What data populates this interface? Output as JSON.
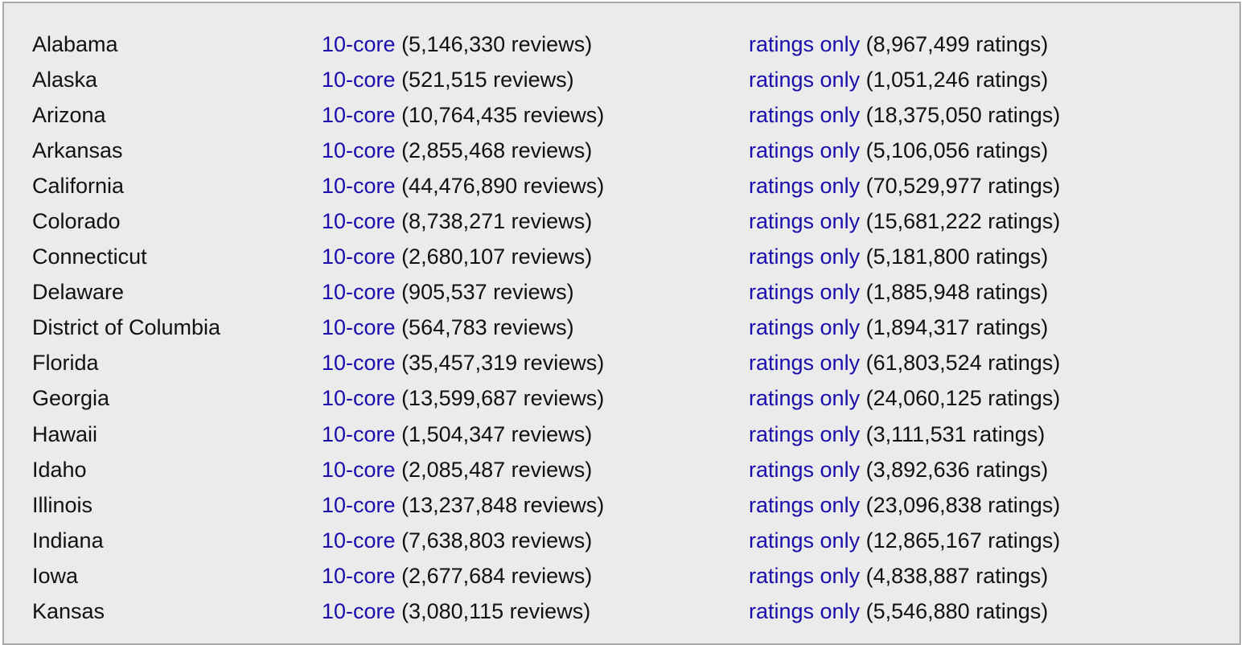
{
  "link_labels": {
    "core": "10-core",
    "ratings": "ratings only"
  },
  "colors": {
    "link": "#1a0dab",
    "text": "#111111",
    "background": "#ebebeb",
    "border": "#a9a9a9"
  },
  "rows": [
    {
      "state": "Alabama",
      "reviews": "(5,146,330 reviews)",
      "ratings": "(8,967,499 ratings)"
    },
    {
      "state": "Alaska",
      "reviews": "(521,515 reviews)",
      "ratings": "(1,051,246 ratings)"
    },
    {
      "state": "Arizona",
      "reviews": "(10,764,435 reviews)",
      "ratings": "(18,375,050 ratings)"
    },
    {
      "state": "Arkansas",
      "reviews": "(2,855,468 reviews)",
      "ratings": "(5,106,056 ratings)"
    },
    {
      "state": "California",
      "reviews": "(44,476,890 reviews)",
      "ratings": "(70,529,977 ratings)"
    },
    {
      "state": "Colorado",
      "reviews": "(8,738,271 reviews)",
      "ratings": "(15,681,222 ratings)"
    },
    {
      "state": "Connecticut",
      "reviews": "(2,680,107 reviews)",
      "ratings": "(5,181,800 ratings)"
    },
    {
      "state": "Delaware",
      "reviews": "(905,537 reviews)",
      "ratings": "(1,885,948 ratings)"
    },
    {
      "state": "District of Columbia",
      "reviews": "(564,783 reviews)",
      "ratings": "(1,894,317 ratings)"
    },
    {
      "state": "Florida",
      "reviews": "(35,457,319 reviews)",
      "ratings": "(61,803,524 ratings)"
    },
    {
      "state": "Georgia",
      "reviews": "(13,599,687 reviews)",
      "ratings": "(24,060,125 ratings)"
    },
    {
      "state": "Hawaii",
      "reviews": "(1,504,347 reviews)",
      "ratings": "(3,111,531 ratings)"
    },
    {
      "state": "Idaho",
      "reviews": "(2,085,487 reviews)",
      "ratings": "(3,892,636 ratings)"
    },
    {
      "state": "Illinois",
      "reviews": "(13,237,848 reviews)",
      "ratings": "(23,096,838 ratings)"
    },
    {
      "state": "Indiana",
      "reviews": "(7,638,803 reviews)",
      "ratings": "(12,865,167 ratings)"
    },
    {
      "state": "Iowa",
      "reviews": "(2,677,684 reviews)",
      "ratings": "(4,838,887 ratings)"
    },
    {
      "state": "Kansas",
      "reviews": "(3,080,115 reviews)",
      "ratings": "(5,546,880 ratings)"
    }
  ]
}
